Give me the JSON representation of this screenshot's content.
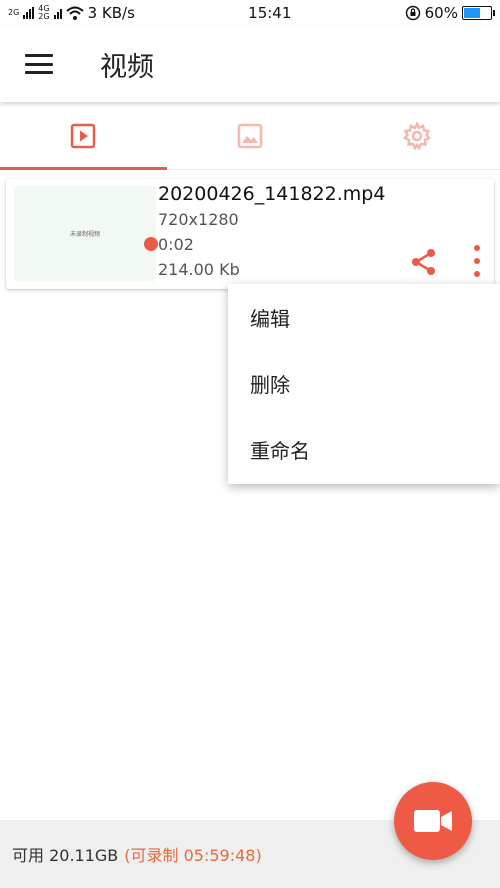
{
  "status_bar": {
    "network_top": "2G",
    "network_mid": "4G",
    "network_bottom": "2G",
    "speed": "3 KB/s",
    "time": "15:41",
    "battery": "60%",
    "battery_level": 0.6,
    "icons": [
      "signal-icon",
      "wifi-icon",
      "rotation-lock-icon",
      "battery-icon"
    ]
  },
  "app_bar": {
    "title": "视频",
    "menu_icon": "hamburger-menu-icon"
  },
  "tabs": [
    {
      "icon": "video-play-icon",
      "active": true
    },
    {
      "icon": "image-icon",
      "active": false
    },
    {
      "icon": "gear-icon",
      "active": false
    }
  ],
  "video_item": {
    "thumbnail_text": "未录制视频",
    "filename": "20200426_141822.mp4",
    "resolution": "720x1280",
    "duration": "0:02",
    "size": "214.00 Kb",
    "share_icon": "share-icon",
    "more_icon": "more-vertical-icon"
  },
  "context_menu": {
    "items": [
      "编辑",
      "删除",
      "重命名"
    ]
  },
  "bottom_bar": {
    "available": "可用 20.11GB",
    "remaining": "(可录制 05:59:48)"
  },
  "fab": {
    "icon": "video-camera-icon"
  },
  "colors": {
    "accent": "#e85c48",
    "fab": "#ef5a47",
    "bottom_bar_bg": "#efefef",
    "remaining_text": "#e86a3a"
  }
}
